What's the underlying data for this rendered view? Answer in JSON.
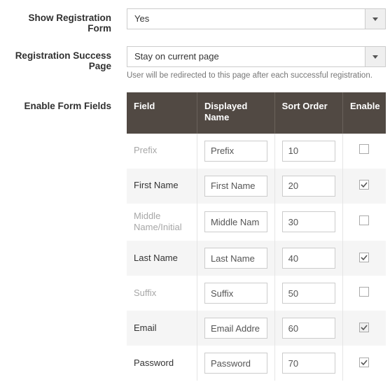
{
  "show_registration": {
    "label": "Show Registration Form",
    "value": "Yes"
  },
  "success_page": {
    "label": "Registration Success Page",
    "value": "Stay on current page",
    "helper": "User will be redirected to this page after each successful registration."
  },
  "fields_section": {
    "label": "Enable Form Fields",
    "columns": {
      "field": "Field",
      "displayed_name": "Displayed Name",
      "sort_order": "Sort Order",
      "enable": "Enable"
    },
    "rows": [
      {
        "field": "Prefix",
        "disabled": true,
        "displayed_name": "Prefix",
        "sort_order": "10",
        "enable": false,
        "locked": false
      },
      {
        "field": "First Name",
        "disabled": false,
        "displayed_name": "First Name",
        "sort_order": "20",
        "enable": true,
        "locked": false
      },
      {
        "field": "Middle Name/Initial",
        "disabled": true,
        "displayed_name": "Middle Nam",
        "sort_order": "30",
        "enable": false,
        "locked": false
      },
      {
        "field": "Last Name",
        "disabled": false,
        "displayed_name": "Last Name",
        "sort_order": "40",
        "enable": true,
        "locked": false
      },
      {
        "field": "Suffix",
        "disabled": true,
        "displayed_name": "Suffix",
        "sort_order": "50",
        "enable": false,
        "locked": false
      },
      {
        "field": "Email",
        "disabled": false,
        "displayed_name": "Email Addre",
        "sort_order": "60",
        "enable": true,
        "locked": true
      },
      {
        "field": "Password",
        "disabled": false,
        "displayed_name": "Password",
        "sort_order": "70",
        "enable": true,
        "locked": false
      }
    ]
  }
}
